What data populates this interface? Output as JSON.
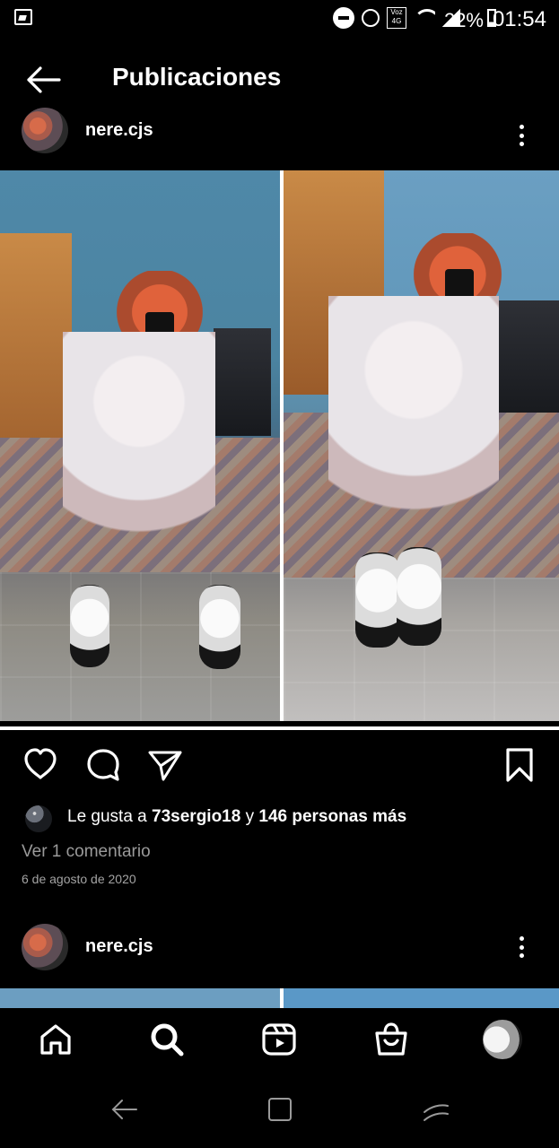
{
  "status_bar": {
    "battery": "22%",
    "time": "01:54",
    "volte_top": "Voz",
    "volte_bottom": "4G"
  },
  "header": {
    "title": "Publicaciones"
  },
  "post_1": {
    "username": "nere.cjs",
    "likes_prefix": "Le gusta a ",
    "likes_user": "73sergio18",
    "likes_middle": " y ",
    "likes_count": "146 personas más",
    "comments_link": "Ver 1 comentario",
    "date": "6 de agosto de 2020"
  },
  "post_2": {
    "username": "nere.cjs"
  },
  "icons": {
    "back": "back-arrow-icon",
    "heart": "heart-icon",
    "comment": "comment-icon",
    "share": "send-icon",
    "save": "bookmark-icon",
    "home": "home-icon",
    "search": "search-icon",
    "reels": "reels-icon",
    "shop": "shop-icon"
  },
  "colors": {
    "background": "#000000",
    "text": "#ffffff",
    "secondary_text": "#9a9a9a"
  }
}
